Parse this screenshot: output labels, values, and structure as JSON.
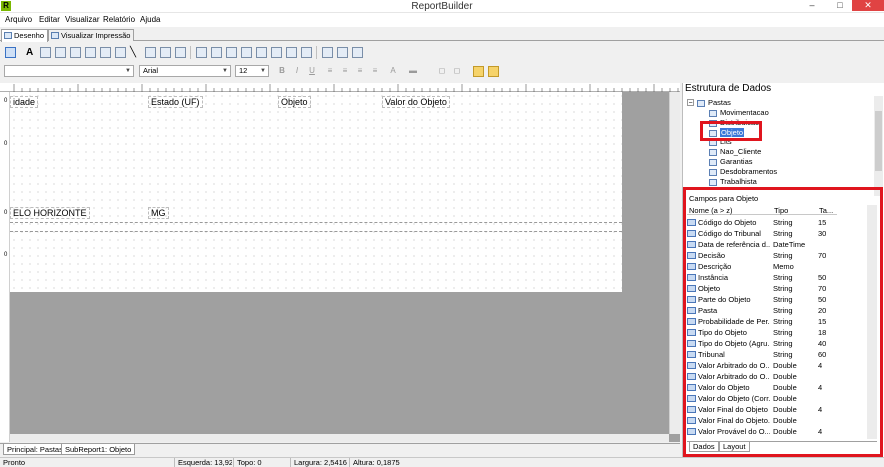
{
  "window": {
    "title": "ReportBuilder",
    "app_icon": "R",
    "minimize": "–",
    "maximize": "□",
    "close": "✕"
  },
  "menu": [
    "Arquivo",
    "Editar",
    "Visualizar",
    "Relatório",
    "Ajuda"
  ],
  "view_tabs": [
    {
      "label": "Desenho",
      "active": true
    },
    {
      "label": "Visualizar Impressão",
      "active": false
    }
  ],
  "format_bar": {
    "component_value": "",
    "font_name": "Arial",
    "font_size": "12",
    "bold": "B",
    "italic": "I",
    "underline": "U"
  },
  "report": {
    "header_fields": [
      "idade",
      "Estado (UF)",
      "Objeto",
      "Valor do Objeto"
    ],
    "detail_fields": [
      "ELO HORIZONTE",
      "MG"
    ],
    "ruler_marks": [
      "0",
      "0",
      "0",
      "0"
    ]
  },
  "bottom_tabs": [
    "Principal: Pastas",
    "SubReport1: Objeto"
  ],
  "status": [
    "Pronto",
    "Esquerda: 13,92",
    "Topo: 0",
    "Largura: 2,5416",
    "Altura: 0,1875"
  ],
  "data_tree": {
    "title": "Estrutura de Dados",
    "root": "Pastas",
    "items": [
      "Movimentacao",
      "Distribuicao",
      "Objeto",
      "Lits",
      "Nao_Cliente",
      "Garantias",
      "Desdobramentos",
      "Trabalhista"
    ],
    "selected": "Objeto"
  },
  "fields_panel": {
    "title": "Campos para Objeto",
    "columns": [
      "Nome (a > z)",
      "Tipo",
      "Ta..."
    ],
    "rows": [
      {
        "name": "Código do Objeto",
        "type": "String",
        "size": "15"
      },
      {
        "name": "Código do Tribunal",
        "type": "String",
        "size": "30"
      },
      {
        "name": "Data de referência d...",
        "type": "DateTime",
        "size": ""
      },
      {
        "name": "Decisão",
        "type": "String",
        "size": "70"
      },
      {
        "name": "Descrição",
        "type": "Memo",
        "size": ""
      },
      {
        "name": "Instância",
        "type": "String",
        "size": "50"
      },
      {
        "name": "Objeto",
        "type": "String",
        "size": "70"
      },
      {
        "name": "Parte do Objeto",
        "type": "String",
        "size": "50"
      },
      {
        "name": "Pasta",
        "type": "String",
        "size": "20"
      },
      {
        "name": "Probabilidade de Per...",
        "type": "String",
        "size": "15"
      },
      {
        "name": "Tipo do Objeto",
        "type": "String",
        "size": "18"
      },
      {
        "name": "Tipo do Objeto (Agru...",
        "type": "String",
        "size": "40"
      },
      {
        "name": "Tribunal",
        "type": "String",
        "size": "60"
      },
      {
        "name": "Valor Arbitrado do O...",
        "type": "Double",
        "size": "4"
      },
      {
        "name": "Valor Arbitrado do O...",
        "type": "Double",
        "size": ""
      },
      {
        "name": "Valor do Objeto",
        "type": "Double",
        "size": "4"
      },
      {
        "name": "Valor do Objeto (Corr...",
        "type": "Double",
        "size": ""
      },
      {
        "name": "Valor Final do Objeto",
        "type": "Double",
        "size": "4"
      },
      {
        "name": "Valor Final do Objeto...",
        "type": "Double",
        "size": ""
      },
      {
        "name": "Valor Provável do O...",
        "type": "Double",
        "size": "4"
      }
    ],
    "tabs": [
      "Dados",
      "Layout"
    ]
  },
  "colors": {
    "highlight_box": "#e0151e",
    "selection": "#3b79d9",
    "canvas_bg": "#a0a0a0"
  }
}
